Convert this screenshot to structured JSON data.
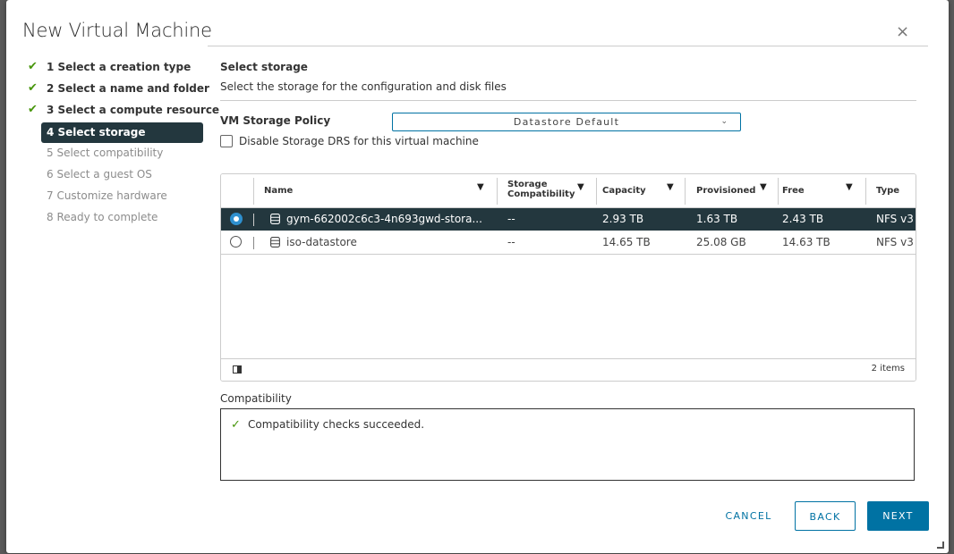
{
  "dialog": {
    "title": "New Virtual Machine",
    "close_glyph": "×"
  },
  "steps": [
    {
      "label": "1 Select a creation type",
      "state": "done"
    },
    {
      "label": "2 Select a name and folder",
      "state": "done"
    },
    {
      "label": "3 Select a compute resource",
      "state": "done"
    },
    {
      "label": "4 Select storage",
      "state": "active"
    },
    {
      "label": "5 Select compatibility",
      "state": "todo"
    },
    {
      "label": "6 Select a guest OS",
      "state": "todo"
    },
    {
      "label": "7 Customize hardware",
      "state": "todo"
    },
    {
      "label": "8 Ready to complete",
      "state": "todo"
    }
  ],
  "storage": {
    "title": "Select storage",
    "description": "Select the storage for the configuration and disk files",
    "policy_label": "VM Storage Policy",
    "policy_value": "Datastore Default",
    "disable_drs_label": "Disable Storage DRS for this virtual machine",
    "disable_drs_checked": false
  },
  "grid": {
    "columns": {
      "name": "Name",
      "storage_compatibility_1": "Storage",
      "storage_compatibility_2": "Compatibility",
      "capacity": "Capacity",
      "provisioned": "Provisioned",
      "free": "Free",
      "type": "Type"
    },
    "rows": [
      {
        "name": "gym-662002c6c3-4n693gwd-stora...",
        "compat": "--",
        "capacity": "2.93 TB",
        "provisioned": "1.63 TB",
        "free": "2.43 TB",
        "type": "NFS v3",
        "selected": true
      },
      {
        "name": "iso-datastore",
        "compat": "--",
        "capacity": "14.65 TB",
        "provisioned": "25.08 GB",
        "free": "14.63 TB",
        "type": "NFS v3",
        "selected": false
      }
    ],
    "footer_count": "2 items"
  },
  "compatibility": {
    "label": "Compatibility",
    "message": "Compatibility checks succeeded."
  },
  "buttons": {
    "cancel": "CANCEL",
    "back": "BACK",
    "next": "NEXT"
  },
  "colors": {
    "accent": "#0072a3",
    "active_step_bg": "#23373e",
    "success": "#48960c"
  }
}
